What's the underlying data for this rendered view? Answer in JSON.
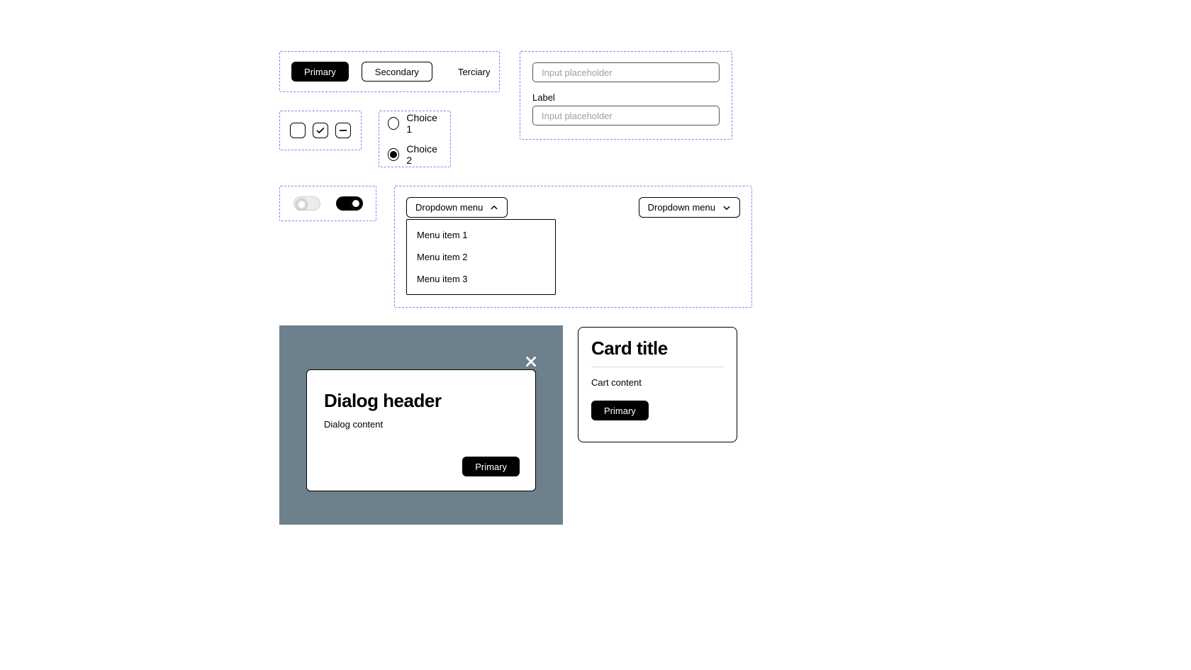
{
  "buttons": {
    "primary": "Primary",
    "secondary": "Secondary",
    "terciary": "Terciary"
  },
  "radios": {
    "choice1": "Choice 1",
    "choice2": "Choice 2"
  },
  "inputs": {
    "placeholder1": "Input placeholder",
    "label": "Label",
    "placeholder2": "Input placeholder"
  },
  "dropdown": {
    "label_open": "Dropdown menu",
    "label_closed": "Dropdown menu",
    "items": {
      "i1": "Menu item 1",
      "i2": "Menu item 2",
      "i3": "Menu item 3"
    }
  },
  "dialog": {
    "header": "Dialog header",
    "content": "Dialog content",
    "action": "Primary"
  },
  "card": {
    "title": "Card title",
    "content": "Cart content",
    "action": "Primary"
  }
}
